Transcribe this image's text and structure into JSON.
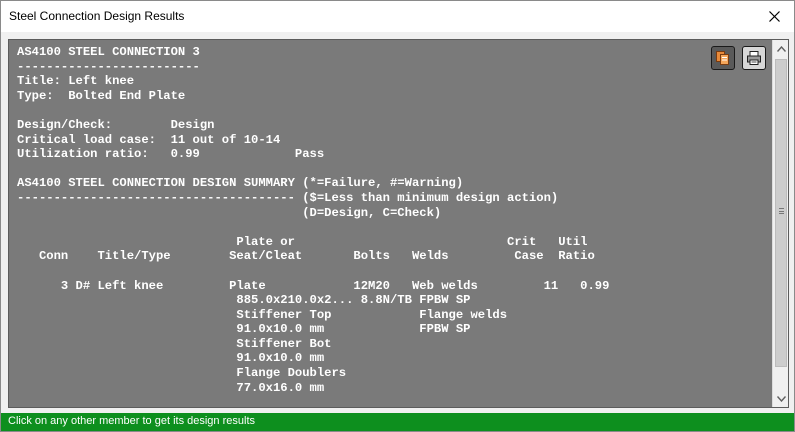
{
  "window": {
    "title": "Steel Connection Design Results"
  },
  "report": {
    "lines": [
      "AS4100 STEEL CONNECTION 3",
      "-------------------------",
      "Title: Left knee",
      "Type:  Bolted End Plate",
      "",
      "Design/Check:        Design",
      "Critical load case:  11 out of 10-14",
      "Utilization ratio:   0.99             Pass",
      "",
      "AS4100 STEEL CONNECTION DESIGN SUMMARY (*=Failure, #=Warning)",
      "-------------------------------------- ($=Less than minimum design action)",
      "                                       (D=Design, C=Check)",
      "",
      "                              Plate or                             Crit   Util",
      "   Conn    Title/Type        Seat/Cleat       Bolts   Welds         Case  Ratio",
      "",
      "      3 D# Left knee         Plate            12M20   Web welds         11   0.99",
      "                              885.0x210.0x2... 8.8N/TB FPBW SP",
      "                              Stiffener Top            Flange welds",
      "                              91.0x10.0 mm             FPBW SP",
      "                              Stiffener Bot",
      "                              91.0x10.0 mm",
      "                              Flange Doublers",
      "                              77.0x16.0 mm"
    ]
  },
  "toolbar": {
    "copy_icon": "copy-icon",
    "print_icon": "print-icon"
  },
  "status": {
    "text": "Click on any other member to get its design results",
    "color": "#0d8f1e"
  }
}
